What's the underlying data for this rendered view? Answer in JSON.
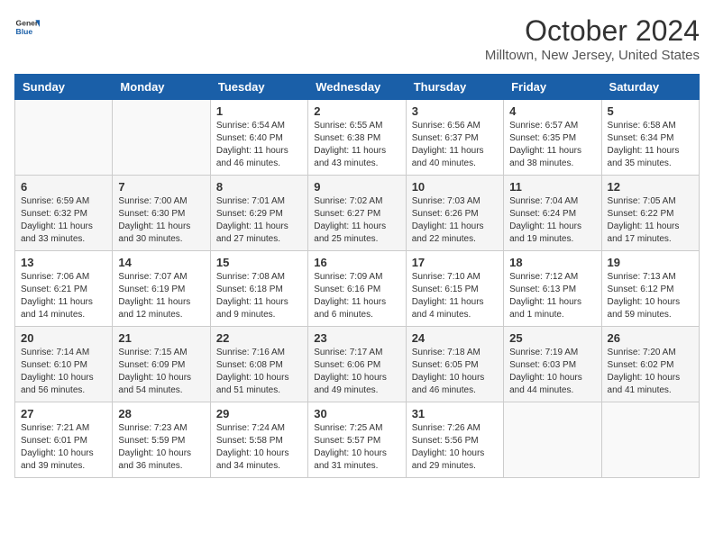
{
  "header": {
    "logo_general": "General",
    "logo_blue": "Blue",
    "title": "October 2024",
    "subtitle": "Milltown, New Jersey, United States"
  },
  "days_of_week": [
    "Sunday",
    "Monday",
    "Tuesday",
    "Wednesday",
    "Thursday",
    "Friday",
    "Saturday"
  ],
  "weeks": [
    [
      {
        "day": "",
        "detail": ""
      },
      {
        "day": "",
        "detail": ""
      },
      {
        "day": "1",
        "detail": "Sunrise: 6:54 AM\nSunset: 6:40 PM\nDaylight: 11 hours and 46 minutes."
      },
      {
        "day": "2",
        "detail": "Sunrise: 6:55 AM\nSunset: 6:38 PM\nDaylight: 11 hours and 43 minutes."
      },
      {
        "day": "3",
        "detail": "Sunrise: 6:56 AM\nSunset: 6:37 PM\nDaylight: 11 hours and 40 minutes."
      },
      {
        "day": "4",
        "detail": "Sunrise: 6:57 AM\nSunset: 6:35 PM\nDaylight: 11 hours and 38 minutes."
      },
      {
        "day": "5",
        "detail": "Sunrise: 6:58 AM\nSunset: 6:34 PM\nDaylight: 11 hours and 35 minutes."
      }
    ],
    [
      {
        "day": "6",
        "detail": "Sunrise: 6:59 AM\nSunset: 6:32 PM\nDaylight: 11 hours and 33 minutes."
      },
      {
        "day": "7",
        "detail": "Sunrise: 7:00 AM\nSunset: 6:30 PM\nDaylight: 11 hours and 30 minutes."
      },
      {
        "day": "8",
        "detail": "Sunrise: 7:01 AM\nSunset: 6:29 PM\nDaylight: 11 hours and 27 minutes."
      },
      {
        "day": "9",
        "detail": "Sunrise: 7:02 AM\nSunset: 6:27 PM\nDaylight: 11 hours and 25 minutes."
      },
      {
        "day": "10",
        "detail": "Sunrise: 7:03 AM\nSunset: 6:26 PM\nDaylight: 11 hours and 22 minutes."
      },
      {
        "day": "11",
        "detail": "Sunrise: 7:04 AM\nSunset: 6:24 PM\nDaylight: 11 hours and 19 minutes."
      },
      {
        "day": "12",
        "detail": "Sunrise: 7:05 AM\nSunset: 6:22 PM\nDaylight: 11 hours and 17 minutes."
      }
    ],
    [
      {
        "day": "13",
        "detail": "Sunrise: 7:06 AM\nSunset: 6:21 PM\nDaylight: 11 hours and 14 minutes."
      },
      {
        "day": "14",
        "detail": "Sunrise: 7:07 AM\nSunset: 6:19 PM\nDaylight: 11 hours and 12 minutes."
      },
      {
        "day": "15",
        "detail": "Sunrise: 7:08 AM\nSunset: 6:18 PM\nDaylight: 11 hours and 9 minutes."
      },
      {
        "day": "16",
        "detail": "Sunrise: 7:09 AM\nSunset: 6:16 PM\nDaylight: 11 hours and 6 minutes."
      },
      {
        "day": "17",
        "detail": "Sunrise: 7:10 AM\nSunset: 6:15 PM\nDaylight: 11 hours and 4 minutes."
      },
      {
        "day": "18",
        "detail": "Sunrise: 7:12 AM\nSunset: 6:13 PM\nDaylight: 11 hours and 1 minute."
      },
      {
        "day": "19",
        "detail": "Sunrise: 7:13 AM\nSunset: 6:12 PM\nDaylight: 10 hours and 59 minutes."
      }
    ],
    [
      {
        "day": "20",
        "detail": "Sunrise: 7:14 AM\nSunset: 6:10 PM\nDaylight: 10 hours and 56 minutes."
      },
      {
        "day": "21",
        "detail": "Sunrise: 7:15 AM\nSunset: 6:09 PM\nDaylight: 10 hours and 54 minutes."
      },
      {
        "day": "22",
        "detail": "Sunrise: 7:16 AM\nSunset: 6:08 PM\nDaylight: 10 hours and 51 minutes."
      },
      {
        "day": "23",
        "detail": "Sunrise: 7:17 AM\nSunset: 6:06 PM\nDaylight: 10 hours and 49 minutes."
      },
      {
        "day": "24",
        "detail": "Sunrise: 7:18 AM\nSunset: 6:05 PM\nDaylight: 10 hours and 46 minutes."
      },
      {
        "day": "25",
        "detail": "Sunrise: 7:19 AM\nSunset: 6:03 PM\nDaylight: 10 hours and 44 minutes."
      },
      {
        "day": "26",
        "detail": "Sunrise: 7:20 AM\nSunset: 6:02 PM\nDaylight: 10 hours and 41 minutes."
      }
    ],
    [
      {
        "day": "27",
        "detail": "Sunrise: 7:21 AM\nSunset: 6:01 PM\nDaylight: 10 hours and 39 minutes."
      },
      {
        "day": "28",
        "detail": "Sunrise: 7:23 AM\nSunset: 5:59 PM\nDaylight: 10 hours and 36 minutes."
      },
      {
        "day": "29",
        "detail": "Sunrise: 7:24 AM\nSunset: 5:58 PM\nDaylight: 10 hours and 34 minutes."
      },
      {
        "day": "30",
        "detail": "Sunrise: 7:25 AM\nSunset: 5:57 PM\nDaylight: 10 hours and 31 minutes."
      },
      {
        "day": "31",
        "detail": "Sunrise: 7:26 AM\nSunset: 5:56 PM\nDaylight: 10 hours and 29 minutes."
      },
      {
        "day": "",
        "detail": ""
      },
      {
        "day": "",
        "detail": ""
      }
    ]
  ]
}
